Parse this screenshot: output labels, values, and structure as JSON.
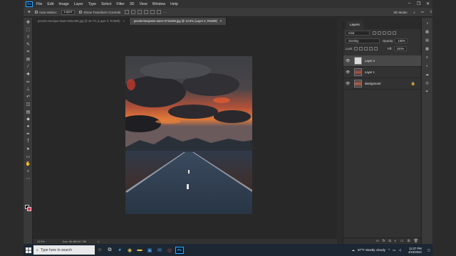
{
  "menu": {
    "app_logo": "Ps",
    "items": [
      "File",
      "Edit",
      "Image",
      "Layer",
      "Type",
      "Select",
      "Filter",
      "3D",
      "View",
      "Window",
      "Help"
    ],
    "window_controls": [
      "–",
      "❐",
      "✕"
    ]
  },
  "options_bar": {
    "auto_select_label": "Auto-Select:",
    "auto_select_value": "Layer",
    "transform_label": "Show Transform Controls",
    "mode_label": "3D Mode:",
    "more_label": "···"
  },
  "tabs": [
    {
      "label": "pexels-monique-laats-4604469.jpg @ 16.7% (Layer 0, RGB/8)",
      "active": false
    },
    {
      "label": "pexels-benjamin-suter-3715269.jpg @ 12.5% (Layer 2, RGB/8)",
      "active": true
    }
  ],
  "status": {
    "zoom": "12.5%",
    "doc_info": "Doc: 46.4M/147.2M",
    "arrow": ">"
  },
  "layers_panel": {
    "tab_label": "Layers",
    "kind_label": "Kind",
    "blend_mode": "Overlay",
    "opacity_label": "Opacity:",
    "opacity_value": "100%",
    "lock_label": "Lock:",
    "fill_label": "Fill:",
    "fill_value": "100%",
    "layers": [
      {
        "name": "Layer 2",
        "selected": true,
        "locked": false
      },
      {
        "name": "Layer 1",
        "selected": false,
        "locked": false
      },
      {
        "name": "Background",
        "selected": false,
        "locked": true
      }
    ]
  },
  "taskbar": {
    "search_placeholder": "Type here to search",
    "weather": "87°F  Mostly cloudy",
    "time": "11:07 PM",
    "date": "4/23/2023",
    "ps_label": "Ps"
  },
  "colors": {
    "foreground_swatch": "#111111",
    "background_swatch": "#e0385a",
    "accent": "#31a8ff"
  }
}
